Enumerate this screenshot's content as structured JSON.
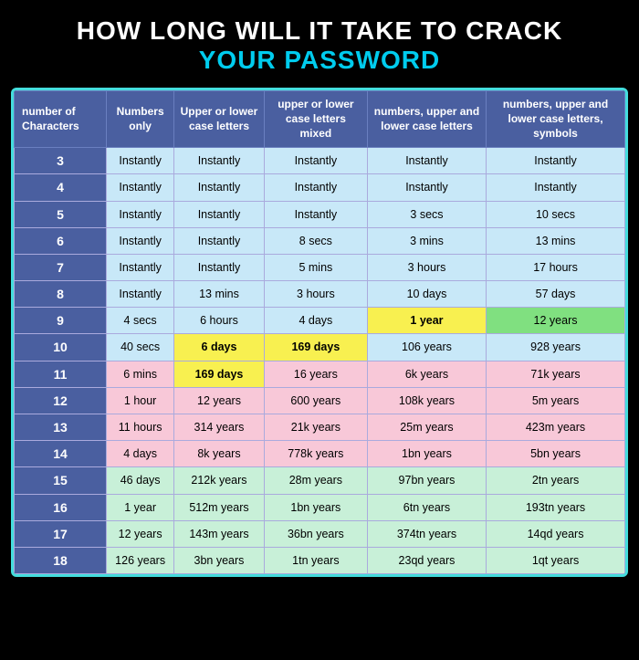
{
  "title": {
    "line1": "HOW LONG WILL IT TAKE TO CRACK",
    "line2": "YOUR PASSWORD"
  },
  "headers": [
    "number of Characters",
    "Numbers only",
    "Upper or lower case letters",
    "upper or lower case letters mixed",
    "numbers, upper and lower case letters",
    "numbers, upper and lower case letters, symbols"
  ],
  "rows": [
    {
      "chars": "3",
      "num": "Instantly",
      "upper_lower": "Instantly",
      "mixed": "Instantly",
      "num_ul": "Instantly",
      "all": "Instantly",
      "rowClass": "row-light-blue"
    },
    {
      "chars": "4",
      "num": "Instantly",
      "upper_lower": "Instantly",
      "mixed": "Instantly",
      "num_ul": "Instantly",
      "all": "Instantly",
      "rowClass": "row-light-blue"
    },
    {
      "chars": "5",
      "num": "Instantly",
      "upper_lower": "Instantly",
      "mixed": "Instantly",
      "num_ul": "3 secs",
      "all": "10 secs",
      "rowClass": "row-light-blue"
    },
    {
      "chars": "6",
      "num": "Instantly",
      "upper_lower": "Instantly",
      "mixed": "8 secs",
      "num_ul": "3 mins",
      "all": "13 mins",
      "rowClass": "row-light-blue"
    },
    {
      "chars": "7",
      "num": "Instantly",
      "upper_lower": "Instantly",
      "mixed": "5 mins",
      "num_ul": "3 hours",
      "all": "17 hours",
      "rowClass": "row-light-blue"
    },
    {
      "chars": "8",
      "num": "Instantly",
      "upper_lower": "13 mins",
      "mixed": "3 hours",
      "num_ul": "10 days",
      "all": "57 days",
      "rowClass": "row-light-blue"
    },
    {
      "chars": "9",
      "num": "4 secs",
      "upper_lower": "6 hours",
      "mixed": "4 days",
      "num_ul": "1 year",
      "all": "12 years",
      "rowClass": "row-light-blue",
      "highlightCol4": true,
      "highlightCol5": true
    },
    {
      "chars": "10",
      "num": "40 secs",
      "upper_lower": "6 days",
      "mixed": "169 days",
      "num_ul": "106 years",
      "all": "928 years",
      "rowClass": "row-light-blue",
      "highlightCol3": true,
      "highlightCol2": true
    },
    {
      "chars": "11",
      "num": "6 mins",
      "upper_lower": "169 days",
      "mixed": "16 years",
      "num_ul": "6k years",
      "all": "71k years",
      "rowClass": "row-light-pink",
      "highlightCol2": true
    },
    {
      "chars": "12",
      "num": "1 hour",
      "upper_lower": "12 years",
      "mixed": "600 years",
      "num_ul": "108k years",
      "all": "5m years",
      "rowClass": "row-light-pink"
    },
    {
      "chars": "13",
      "num": "11 hours",
      "upper_lower": "314 years",
      "mixed": "21k years",
      "num_ul": "25m years",
      "all": "423m years",
      "rowClass": "row-light-pink"
    },
    {
      "chars": "14",
      "num": "4 days",
      "upper_lower": "8k years",
      "mixed": "778k years",
      "num_ul": "1bn years",
      "all": "5bn years",
      "rowClass": "row-light-pink"
    },
    {
      "chars": "15",
      "num": "46 days",
      "upper_lower": "212k years",
      "mixed": "28m years",
      "num_ul": "97bn years",
      "all": "2tn years",
      "rowClass": "row-light-green"
    },
    {
      "chars": "16",
      "num": "1 year",
      "upper_lower": "512m years",
      "mixed": "1bn years",
      "num_ul": "6tn years",
      "all": "193tn years",
      "rowClass": "row-light-green"
    },
    {
      "chars": "17",
      "num": "12 years",
      "upper_lower": "143m years",
      "mixed": "36bn years",
      "num_ul": "374tn years",
      "all": "14qd years",
      "rowClass": "row-light-green"
    },
    {
      "chars": "18",
      "num": "126 years",
      "upper_lower": "3bn years",
      "mixed": "1tn years",
      "num_ul": "23qd years",
      "all": "1qt years",
      "rowClass": "row-light-green"
    }
  ]
}
